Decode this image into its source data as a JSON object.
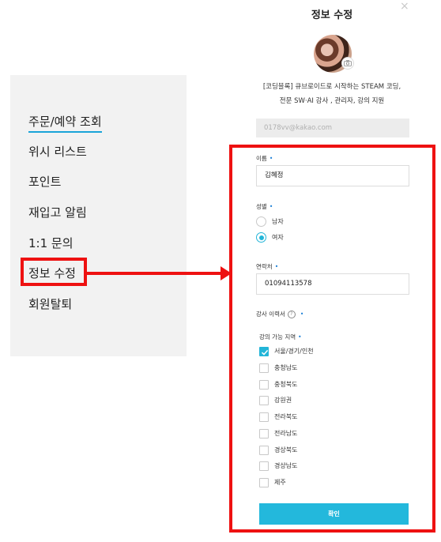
{
  "sidebar": {
    "items": [
      {
        "label": "주문/예약 조회",
        "active": true
      },
      {
        "label": "위시 리스트"
      },
      {
        "label": "포인트"
      },
      {
        "label": "재입고 알림"
      },
      {
        "label": "1:1 문의"
      },
      {
        "label": "정보 수정"
      },
      {
        "label": "회원탈퇴"
      }
    ]
  },
  "panel": {
    "title": "정보 수정",
    "close_label": "×",
    "intro_line1": "[코딩블록] 큐브로이드로 시작하는 STEAM 코딩,",
    "intro_line2": "전문 SW·AI 강사 , 관리자, 강의 지원",
    "email_placeholder": "0178vv@kakao.com"
  },
  "form": {
    "name_label": "이름",
    "name_value": "김혜정",
    "gender_label": "성별",
    "gender_options": [
      {
        "label": "남자",
        "checked": false
      },
      {
        "label": "여자",
        "checked": true
      }
    ],
    "phone_label": "연락처",
    "phone_value": "01094113578",
    "career_label": "강사 이력서",
    "help_glyph": "?",
    "region_label": "강의 가능 지역",
    "regions": [
      {
        "label": "서울/경기/인천",
        "checked": true
      },
      {
        "label": "충청남도",
        "checked": false
      },
      {
        "label": "충청북도",
        "checked": false
      },
      {
        "label": "강원권",
        "checked": false
      },
      {
        "label": "전라북도",
        "checked": false
      },
      {
        "label": "전라남도",
        "checked": false
      },
      {
        "label": "경상북도",
        "checked": false
      },
      {
        "label": "경상남도",
        "checked": false
      },
      {
        "label": "제주",
        "checked": false
      }
    ],
    "required_mark": "•",
    "confirm_label": "확인"
  },
  "colors": {
    "accent": "#23b8dc",
    "annotation": "#ee1111",
    "required": "#1a7ed6"
  }
}
